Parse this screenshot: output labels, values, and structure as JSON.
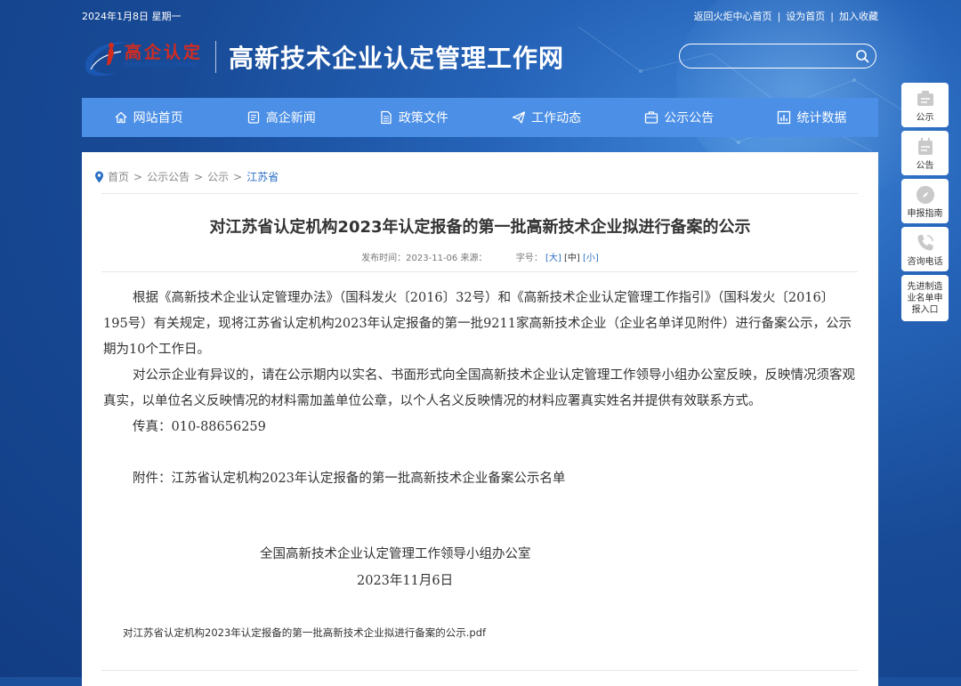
{
  "topbar": {
    "date": "2024年1月8日 星期一",
    "links": [
      "返回火炬中心首页",
      "设为首页",
      "加入收藏"
    ]
  },
  "logo": {
    "cn": "高企认定",
    "en": "INNOVATION COMPANY",
    "site_title": "高新技术企业认定管理工作网"
  },
  "search": {
    "placeholder": ""
  },
  "nav": {
    "items": [
      {
        "label": "网站首页",
        "icon": "home-icon"
      },
      {
        "label": "高企新闻",
        "icon": "news-icon"
      },
      {
        "label": "政策文件",
        "icon": "document-icon"
      },
      {
        "label": "工作动态",
        "icon": "paper-plane-icon"
      },
      {
        "label": "公示公告",
        "icon": "briefcase-icon"
      },
      {
        "label": "统计数据",
        "icon": "bar-chart-icon"
      }
    ]
  },
  "breadcrumb": {
    "items": [
      "首页",
      "公示公告",
      "公示"
    ],
    "current": "江苏省"
  },
  "article": {
    "title": "对江苏省认定机构2023年认定报备的第一批高新技术企业拟进行备案的公示",
    "meta_time_label": "发布时间：",
    "meta_time": "2023-11-06",
    "meta_source_label": "来源：",
    "meta_font_label": "字号：",
    "font_sizes": [
      "[大]",
      "[中]",
      "[小]"
    ],
    "paragraphs": [
      "根据《高新技术企业认定管理办法》（国科发火〔2016〕32号）和《高新技术企业认定管理工作指引》（国科发火〔2016〕195号）有关规定，现将江苏省认定机构2023年认定报备的第一批9211家高新技术企业（企业名单详见附件）进行备案公示，公示期为10个工作日。",
      "对公示企业有异议的，请在公示期内以实名、书面形式向全国高新技术企业认定管理工作领导小组办公室反映，反映情况须客观真实，以单位名义反映情况的材料需加盖单位公章，以个人名义反映情况的材料应署真实姓名并提供有效联系方式。",
      "传真：010-88656259",
      "附件：江苏省认定机构2023年认定报备的第一批高新技术企业备案公示名单"
    ],
    "signature_org": "全国高新技术企业认定管理工作领导小组办公室",
    "signature_date": "2023年11月6日",
    "attachment": "对江苏省认定机构2023年认定报备的第一批高新技术企业拟进行备案的公示.pdf"
  },
  "sidebar": {
    "items": [
      {
        "label": "公示",
        "icon": "notice-board-icon"
      },
      {
        "label": "公告",
        "icon": "calendar-icon"
      },
      {
        "label": "申报指南",
        "icon": "compass-icon"
      },
      {
        "label": "咨询电话",
        "icon": "phone-icon"
      },
      {
        "label": "先进制造业名单申报入口",
        "lines": [
          "先进制造",
          "业名单申",
          "报入口"
        ]
      }
    ]
  },
  "colors": {
    "nav_bg": "#4b8fe6",
    "link": "#2b6fc4",
    "logo_red": "#d52b1e"
  }
}
